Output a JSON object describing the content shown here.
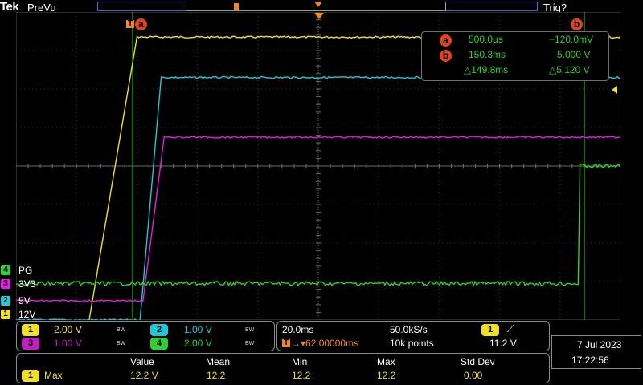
{
  "header": {
    "logo": "Tek",
    "mode": "PreVu",
    "trigger_status": "Trig?"
  },
  "cursors": {
    "a_label": "a",
    "b_label": "b",
    "trigger_marker": "T"
  },
  "cursor_readout": {
    "a": {
      "label": "a",
      "time": "500.0µs",
      "value": "−120.0mV"
    },
    "b": {
      "label": "b",
      "time": "150.3ms",
      "value": "5.000 V"
    },
    "delta": {
      "time": "△149.8ms",
      "value": "△5.120 V"
    }
  },
  "channels": [
    {
      "num": "4",
      "name": "PG",
      "color": "#2fd02f"
    },
    {
      "num": "3",
      "name": "3V3",
      "color": "#e020e0"
    },
    {
      "num": "2",
      "name": "5V",
      "color": "#20c8d8"
    },
    {
      "num": "1",
      "name": "12V",
      "color": "#f0e020"
    }
  ],
  "vertical_settings": [
    {
      "num": "1",
      "scale": "2.00 V",
      "bw": "BW",
      "color": "#f0e020"
    },
    {
      "num": "2",
      "scale": "1.00 V",
      "bw": "BW",
      "color": "#20c8d8"
    },
    {
      "num": "3",
      "scale": "1.00 V",
      "bw": "BW",
      "color": "#e020e0"
    },
    {
      "num": "4",
      "scale": "2.00 V",
      "bw": "BW",
      "color": "#2fd02f"
    }
  ],
  "horizontal": {
    "time_div": "20.0ms",
    "sample_rate": "50.0kS/s",
    "position": "→▾62.00000ms",
    "record_length": "10k points",
    "trigger_source": "1",
    "trigger_slope": "⟋",
    "trigger_level": "11.2 V"
  },
  "datetime": {
    "date": "7 Jul  2023",
    "time": "17:22:56"
  },
  "measurements": {
    "headers": [
      "Value",
      "Mean",
      "Min",
      "Max",
      "Std Dev"
    ],
    "row": {
      "source": "1",
      "type": "Max",
      "values": [
        "12.2 V",
        "12.2",
        "12.2",
        "12.2",
        "0.00"
      ]
    }
  },
  "chart_data": {
    "type": "line",
    "title": "",
    "xlabel": "",
    "ylabel": "",
    "x_unit_per_div": "20.0ms",
    "grid": true,
    "series": [
      {
        "name": "12V",
        "values_div": [
          [
            0.0,
            -4.55
          ],
          [
            1.15,
            -4.55
          ],
          [
            2.0,
            3.35
          ],
          [
            10.0,
            3.35
          ]
        ]
      },
      {
        "name": "5V",
        "values_div": [
          [
            0.0,
            -4.0
          ],
          [
            2.05,
            -4.0
          ],
          [
            2.4,
            2.3
          ],
          [
            10.0,
            2.3
          ]
        ]
      },
      {
        "name": "3V3",
        "values_div": [
          [
            0.0,
            -3.5
          ],
          [
            2.1,
            -3.5
          ],
          [
            2.45,
            0.75
          ],
          [
            10.0,
            0.75
          ]
        ]
      },
      {
        "name": "PG",
        "values_div": [
          [
            0.0,
            -3.05
          ],
          [
            9.3,
            -3.05
          ],
          [
            9.33,
            0.0
          ],
          [
            10.0,
            0.0
          ]
        ]
      }
    ]
  }
}
